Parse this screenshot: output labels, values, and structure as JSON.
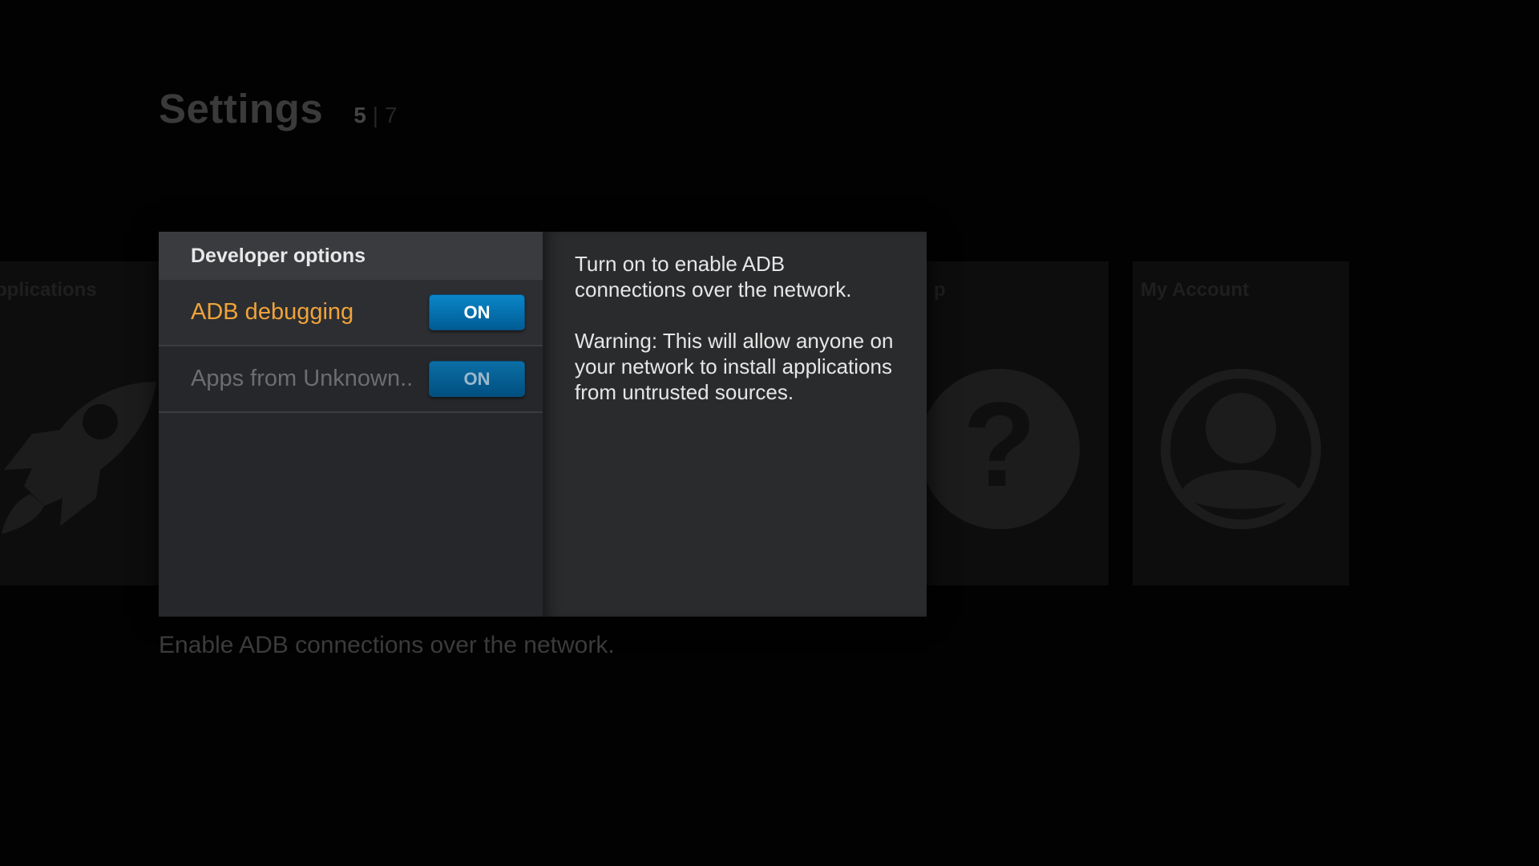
{
  "header": {
    "title": "Settings",
    "pager_current": "5",
    "pager_separator": "|",
    "pager_total": "7"
  },
  "background_tiles": {
    "applications_label": "pplications",
    "help_label": "p",
    "account_label": "My Account"
  },
  "dialog": {
    "heading": "Developer options",
    "options": [
      {
        "label": "ADB debugging",
        "state": "ON",
        "selected": true
      },
      {
        "label": "Apps from Unknown..",
        "state": "ON",
        "selected": false
      }
    ],
    "description_lines": [
      "Turn on to enable ADB connections over the network.",
      "Warning: This will allow anyone on your network to install applications from untrusted sources."
    ]
  },
  "footer": {
    "hint": "Enable ADB connections over the network."
  },
  "colors": {
    "accent_selected": "#f0a33a",
    "toggle_blue": "#0b86c8",
    "background": "#020202"
  },
  "icons": {
    "applications_tile": "rocket-icon",
    "help_tile": "question-icon",
    "account_tile": "user-icon"
  }
}
